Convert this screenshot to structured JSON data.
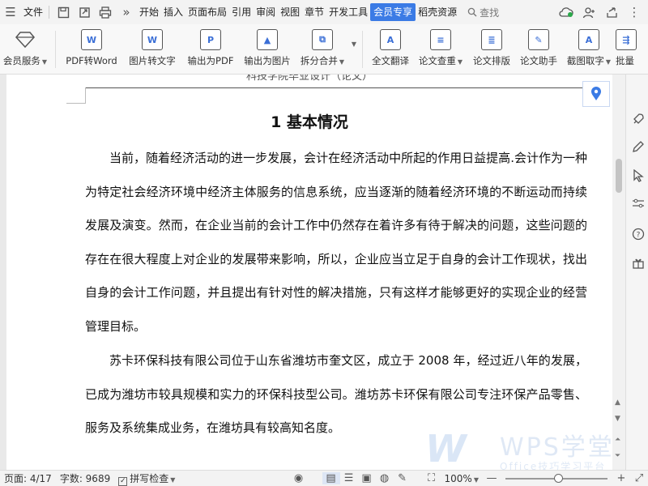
{
  "menubar": {
    "file": "文件",
    "tabs": [
      "开始",
      "插入",
      "页面布局",
      "引用",
      "审阅",
      "视图",
      "章节",
      "开发工具",
      "会员专享",
      "稻壳资源"
    ],
    "active_tab": "会员专享",
    "search": "查找",
    "more": "»"
  },
  "ribbon": {
    "buttons": [
      {
        "label": "会员服务",
        "caret": true,
        "icon": "diamond-icon"
      },
      {
        "label": "PDF转Word",
        "caret": false,
        "icon": "pdf-to-word-icon",
        "glyph": "W"
      },
      {
        "label": "图片转文字",
        "caret": false,
        "icon": "image-to-text-icon",
        "glyph": "W"
      },
      {
        "label": "输出为PDF",
        "caret": false,
        "icon": "export-pdf-icon",
        "glyph": "P"
      },
      {
        "label": "输出为图片",
        "caret": false,
        "icon": "export-image-icon",
        "glyph": "▲"
      },
      {
        "label": "拆分合并",
        "caret": true,
        "icon": "split-merge-icon",
        "glyph": "⧉"
      },
      {
        "label": "全文翻译",
        "caret": false,
        "icon": "translate-icon",
        "glyph": "A"
      },
      {
        "label": "论文查重",
        "caret": true,
        "icon": "plagiarism-check-icon",
        "glyph": "≡"
      },
      {
        "label": "论文排版",
        "caret": false,
        "icon": "paper-layout-icon",
        "glyph": "≣"
      },
      {
        "label": "论文助手",
        "caret": false,
        "icon": "paper-assistant-icon",
        "glyph": "✎"
      },
      {
        "label": "截图取字",
        "caret": true,
        "icon": "screenshot-text-icon",
        "glyph": "A"
      },
      {
        "label": "批量",
        "caret": false,
        "icon": "batch-icon",
        "glyph": "⇶"
      }
    ]
  },
  "document": {
    "header_text": "科技学院毕业设计（论文）",
    "title": "1 基本情况",
    "paragraphs": [
      "当前，随着经济活动的进一步发展，会计在经济活动中所起的作用日益提高.会计作为一种为特定社会经济环境中经济主体服务的信息系统，应当逐渐的随着经济环境的不断运动而持续发展及演变。然而，在企业当前的会计工作中仍然存在着许多有待于解决的问题，这些问题的存在在很大程度上对企业的发展带来影响，所以，企业应当立足于自身的会计工作现状，找出自身的会计工作问题，并且提出有针对性的解决措施，只有这样才能够更好的实现企业的经营管理目标。",
      "苏卡环保科技有限公司位于山东省潍坊市奎文区，成立于 2008 年，经过近八年的发展，已成为潍坊市较具规模和实力的环保科技型公司。潍坊苏卡环保有限公司专注环保产品零售、服务及系统集成业务，在潍坊具有较高知名度。"
    ]
  },
  "watermark": {
    "title": "WPS学堂",
    "subtitle": "Office技巧学习平台"
  },
  "statusbar": {
    "page": "页面: 4/17",
    "word_count": "字数: 9689",
    "spell_check": "拼写检查",
    "zoom": "100%",
    "zoom_level_percent": 100
  },
  "colors": {
    "accent": "#3b7be5",
    "watermark": "#bcd3ef"
  }
}
